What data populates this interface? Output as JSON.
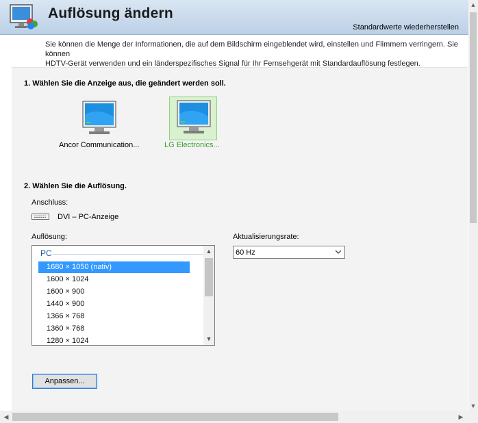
{
  "header": {
    "title": "Auflösung ändern",
    "restore_label": "Standardwerte wiederherstellen"
  },
  "intro": {
    "line1": "Sie können die Menge der Informationen, die auf dem Bildschirm eingeblendet wird, einstellen und Flimmern verringern. Sie können",
    "line2": "HDTV-Gerät verwenden und ein länderspezifisches Signal für Ihr Fernsehgerät mit Standardauflösung festlegen."
  },
  "section1": {
    "title": "1. Wählen Sie die Anzeige aus, die geändert werden soll.",
    "displays": [
      {
        "label": "Ancor Communication...",
        "selected": false
      },
      {
        "label": "LG Electronics...",
        "selected": true
      }
    ]
  },
  "section2": {
    "title": "2. Wählen Sie die Auflösung.",
    "connection_label": "Anschluss:",
    "connection_value": "DVI – PC-Anzeige",
    "resolution_label": "Auflösung:",
    "group": "PC",
    "resolutions": [
      "1680 × 1050 (nativ)",
      "1600 × 1024",
      "1600 × 900",
      "1440 × 900",
      "1366 × 768",
      "1360 × 768",
      "1280 × 1024"
    ],
    "selected_index": 0,
    "refresh_label": "Aktualisierungsrate:",
    "refresh_value": "60 Hz",
    "customize_label": "Anpassen..."
  },
  "colors": {
    "accent": "#3399ff",
    "selected_display_bg": "#d9f1cf",
    "selected_display_text": "#3a9a2a",
    "group_header": "#1e5aa8"
  },
  "icons": [
    "display-settings-icon",
    "monitor-icon",
    "dvi-connector-icon",
    "chevron-down-icon",
    "scroll-arrow-icon"
  ]
}
